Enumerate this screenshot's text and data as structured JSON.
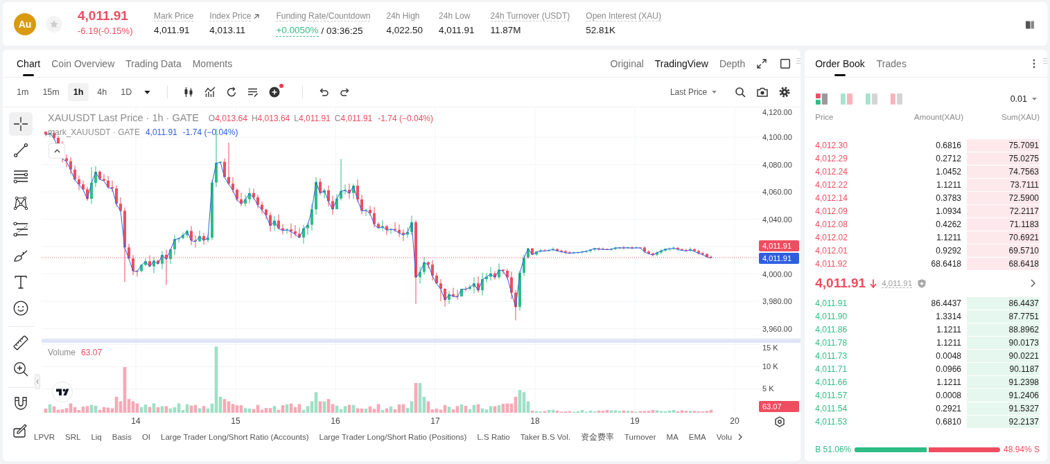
{
  "header": {
    "coin": "Au",
    "favorite": false,
    "last_price": "4,011.91",
    "change": "-6.19(-0.15%)",
    "falling": true,
    "stats": [
      {
        "label": "Mark Price",
        "value": "4,011.91",
        "kind": "plain",
        "tooltip": true
      },
      {
        "label": "Index Price",
        "value": "4,013.11",
        "kind": "link",
        "tooltip": true
      },
      {
        "label": "Funding Rate/Countdown",
        "value": "+0.0050%",
        "countdown": "/ 03:36:25",
        "kind": "funding",
        "tooltip": true
      },
      {
        "label": "24h High",
        "value": "4,022.50",
        "kind": "plain",
        "tooltip": false
      },
      {
        "label": "24h Low",
        "value": "4,011.91",
        "kind": "plain",
        "tooltip": false
      },
      {
        "label": "24h Turnover (USDT)",
        "value": "11.87M",
        "kind": "plain",
        "tooltip": true
      },
      {
        "label": "Open Interest (XAU)",
        "value": "52.81K",
        "kind": "plain",
        "tooltip": true
      }
    ]
  },
  "chart_panel": {
    "tabs": [
      {
        "label": "Chart",
        "selected": true
      },
      {
        "label": "Coin Overview",
        "selected": false
      },
      {
        "label": "Trading Data",
        "selected": false
      },
      {
        "label": "Moments",
        "selected": false
      }
    ],
    "views": [
      {
        "label": "Original",
        "selected": false
      },
      {
        "label": "TradingView",
        "selected": true
      },
      {
        "label": "Depth",
        "selected": false
      }
    ],
    "intervals": [
      {
        "label": "1m",
        "selected": false
      },
      {
        "label": "15m",
        "selected": false
      },
      {
        "label": "1h",
        "selected": true
      },
      {
        "label": "4h",
        "selected": false
      },
      {
        "label": "1D",
        "selected": false
      }
    ],
    "price_source": "Last Price",
    "tool_groups": [
      [
        {
          "kind": "crosshair",
          "selected": true
        },
        {
          "kind": "trend-line",
          "selected": false
        },
        {
          "kind": "horizontal-lines",
          "selected": false
        },
        {
          "kind": "pattern",
          "selected": false
        },
        {
          "kind": "fibonacci",
          "selected": false
        },
        {
          "kind": "brush",
          "selected": false
        },
        {
          "kind": "text",
          "selected": false
        },
        {
          "kind": "emoji",
          "selected": false
        }
      ],
      [
        {
          "kind": "ruler",
          "selected": false
        },
        {
          "kind": "zoom-in",
          "selected": false
        }
      ],
      [
        {
          "kind": "magnet",
          "selected": false
        },
        {
          "kind": "lock-drawing",
          "selected": false
        }
      ]
    ],
    "legend": {
      "title": "XAUUSDT Last Price · 1h · GATE",
      "falling": true,
      "ohlc": [
        {
          "key": "O",
          "value": "4,013.64"
        },
        {
          "key": "H",
          "value": "4,013.64"
        },
        {
          "key": "L",
          "value": "4,011.91"
        },
        {
          "key": "C",
          "value": "4,011.91"
        }
      ],
      "change": "-1.74 (−0.04%)"
    },
    "mark_legend": {
      "title": "mark_XAUUSDT · GATE",
      "value": "4,011.91",
      "change": "-1.74 (−0.04%)"
    },
    "price_axis": [
      "4,120.00",
      "4,100.00",
      "4,080.00",
      "4,060.00",
      "4,040.00",
      "4,000.00",
      "3,980.00",
      "3,960.00"
    ],
    "price_tags": [
      {
        "kind": "last",
        "value": "4,011.91"
      },
      {
        "kind": "mark",
        "value": "4,011.91"
      }
    ],
    "volume": {
      "label": "Volume",
      "value": "63.07",
      "falling": true,
      "axis": [
        "15 K",
        "10 K",
        "5 K"
      ],
      "tag": "63.07"
    },
    "time_axis": [
      "14",
      "15",
      "16",
      "17",
      "18",
      "19",
      "20"
    ],
    "indicators": [
      "LPVR",
      "SRL",
      "Liq",
      "Basis",
      "OI",
      "Large Trader Long/Short Ratio (Accounts)",
      "Large Trader Long/Short Ratio (Positions)",
      "L.S Ratio",
      "Taker B.S Vol.",
      "资金费率",
      "Turnover",
      "MA",
      "EMA",
      "Volu"
    ]
  },
  "order_book": {
    "tabs": [
      {
        "label": "Order Book",
        "selected": true
      },
      {
        "label": "Trades",
        "selected": false
      }
    ],
    "display_modes": [
      {
        "kind": "both",
        "selected": true
      },
      {
        "kind": "split",
        "selected": false
      },
      {
        "kind": "bids",
        "selected": false
      },
      {
        "kind": "asks",
        "selected": false
      }
    ],
    "precision": "0.01",
    "columns": [
      "Price",
      "Amount(XAU)",
      "Sum(XAU)"
    ],
    "asks": [
      {
        "price": "4,012.30",
        "amount": "0.6816",
        "sum": "75.7091"
      },
      {
        "price": "4,012.29",
        "amount": "0.2712",
        "sum": "75.0275"
      },
      {
        "price": "4,012.24",
        "amount": "1.0452",
        "sum": "74.7563"
      },
      {
        "price": "4,012.22",
        "amount": "1.1211",
        "sum": "73.7111"
      },
      {
        "price": "4,012.14",
        "amount": "0.3783",
        "sum": "72.5900"
      },
      {
        "price": "4,012.09",
        "amount": "1.0934",
        "sum": "72.2117"
      },
      {
        "price": "4,012.08",
        "amount": "0.4262",
        "sum": "71.1183"
      },
      {
        "price": "4,012.02",
        "amount": "1.1211",
        "sum": "70.6921"
      },
      {
        "price": "4,012.01",
        "amount": "0.9292",
        "sum": "69.5710"
      },
      {
        "price": "4,011.92",
        "amount": "68.6418",
        "sum": "68.6418"
      }
    ],
    "mid": {
      "price": "4,011.91",
      "falling": true,
      "mark": "4,011.91"
    },
    "bids": [
      {
        "price": "4,011.91",
        "amount": "86.4437",
        "sum": "86.4437"
      },
      {
        "price": "4,011.90",
        "amount": "1.3314",
        "sum": "87.7751"
      },
      {
        "price": "4,011.86",
        "amount": "1.1211",
        "sum": "88.8962"
      },
      {
        "price": "4,011.78",
        "amount": "1.1211",
        "sum": "90.0173"
      },
      {
        "price": "4,011.73",
        "amount": "0.0048",
        "sum": "90.0221"
      },
      {
        "price": "4,011.71",
        "amount": "0.0966",
        "sum": "90.1187"
      },
      {
        "price": "4,011.66",
        "amount": "1.1211",
        "sum": "91.2398"
      },
      {
        "price": "4,011.57",
        "amount": "0.0008",
        "sum": "91.2406"
      },
      {
        "price": "4,011.54",
        "amount": "0.2921",
        "sum": "91.5327"
      },
      {
        "price": "4,011.53",
        "amount": "0.6810",
        "sum": "92.2137"
      }
    ],
    "ratio": {
      "buy": "B 51.06%",
      "sell": "48.94% S",
      "level": 0.5106
    }
  }
}
